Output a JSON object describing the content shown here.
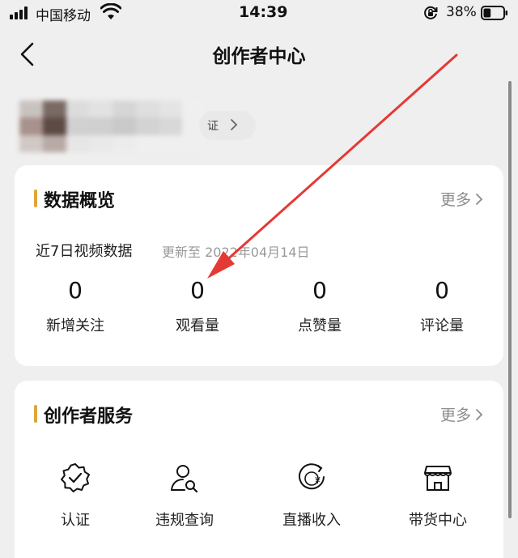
{
  "status_bar": {
    "carrier": "中国移动",
    "time": "14:39",
    "battery_percent": "38%",
    "battery_level": 0.38,
    "icons": [
      "signal-icon",
      "wifi-icon",
      "orientation-lock-icon",
      "battery-icon"
    ]
  },
  "nav": {
    "title": "创作者中心",
    "back_icon": "chevron-left-icon"
  },
  "profile": {
    "verify_text": "证"
  },
  "data_overview": {
    "title": "数据概览",
    "more_label": "更多",
    "subtitle": "近7日视频数据",
    "update_text": "更新至 2022年04月14日",
    "stats": [
      {
        "value": "0",
        "label": "新增关注"
      },
      {
        "value": "0",
        "label": "观看量"
      },
      {
        "value": "0",
        "label": "点赞量"
      },
      {
        "value": "0",
        "label": "评论量"
      }
    ]
  },
  "creator_services": {
    "title": "创作者服务",
    "more_label": "更多",
    "items": [
      {
        "label": "认证",
        "icon": "verified-badge-icon"
      },
      {
        "label": "违规查询",
        "icon": "user-search-icon"
      },
      {
        "label": "直播收入",
        "icon": "yuan-coin-icon"
      },
      {
        "label": "带货中心",
        "icon": "storefront-icon"
      }
    ]
  },
  "colors": {
    "accent": "#e0a53a",
    "annotation_arrow": "#e53935",
    "background": "#efefef",
    "card": "#ffffff"
  }
}
